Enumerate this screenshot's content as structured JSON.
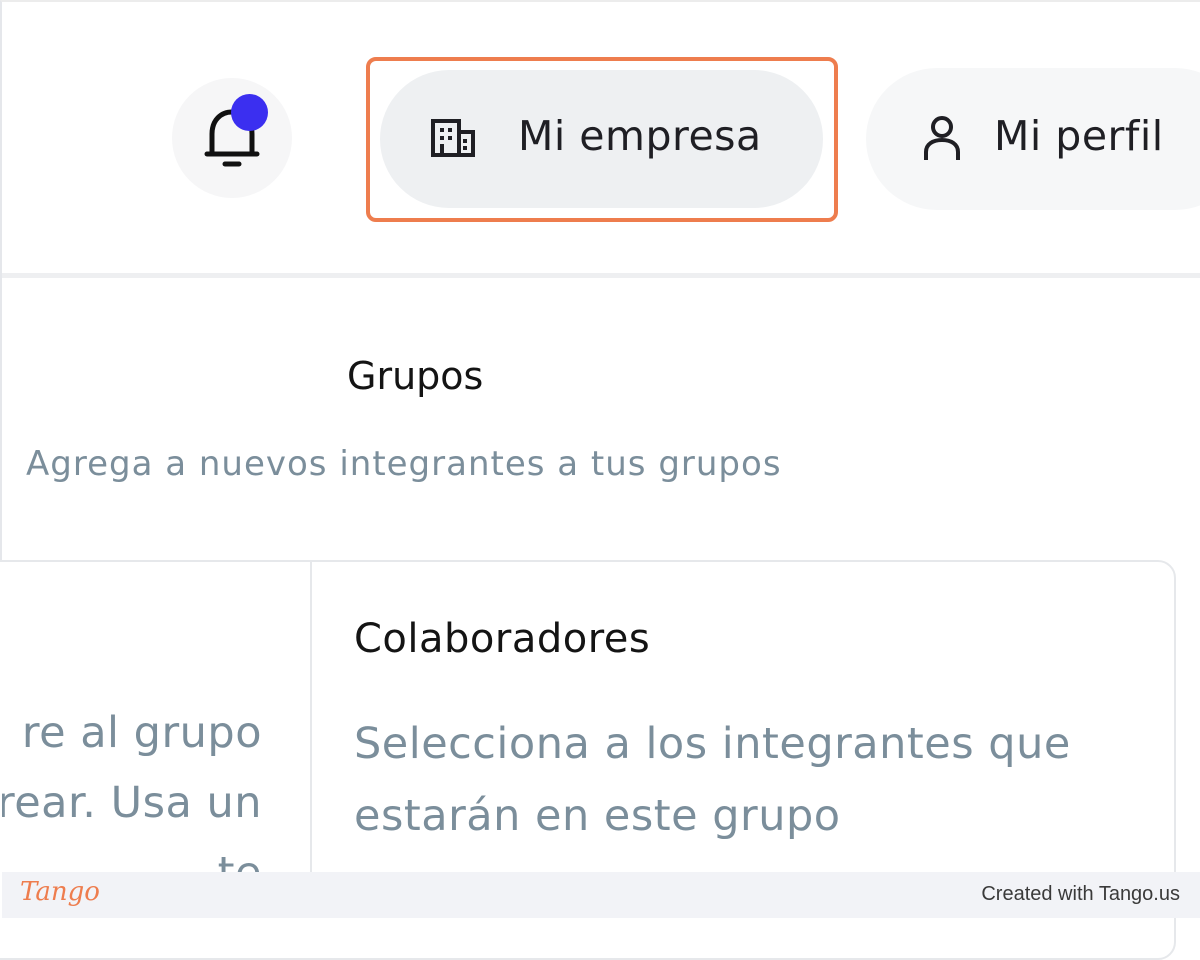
{
  "header": {
    "notifications_icon": "bell-icon",
    "company_button": {
      "label": "Mi empresa",
      "icon": "building-icon"
    },
    "profile_button": {
      "label": "Mi perfil",
      "icon": "user-icon"
    },
    "badge_color": "#3b2ff0",
    "highlight_color": "#ee7d4e"
  },
  "groups": {
    "title": "Grupos",
    "subtitle": "Agrega a nuevos integrantes a tus grupos"
  },
  "left_column": {
    "lines": [
      "re al grupo",
      "rear. Usa un",
      "te"
    ]
  },
  "collaborators": {
    "title": "Colaboradores",
    "description": "Selecciona a los integrantes que estarán en este grupo"
  },
  "footer": {
    "logo": "Tango",
    "created_with": "Created with Tango.us"
  }
}
